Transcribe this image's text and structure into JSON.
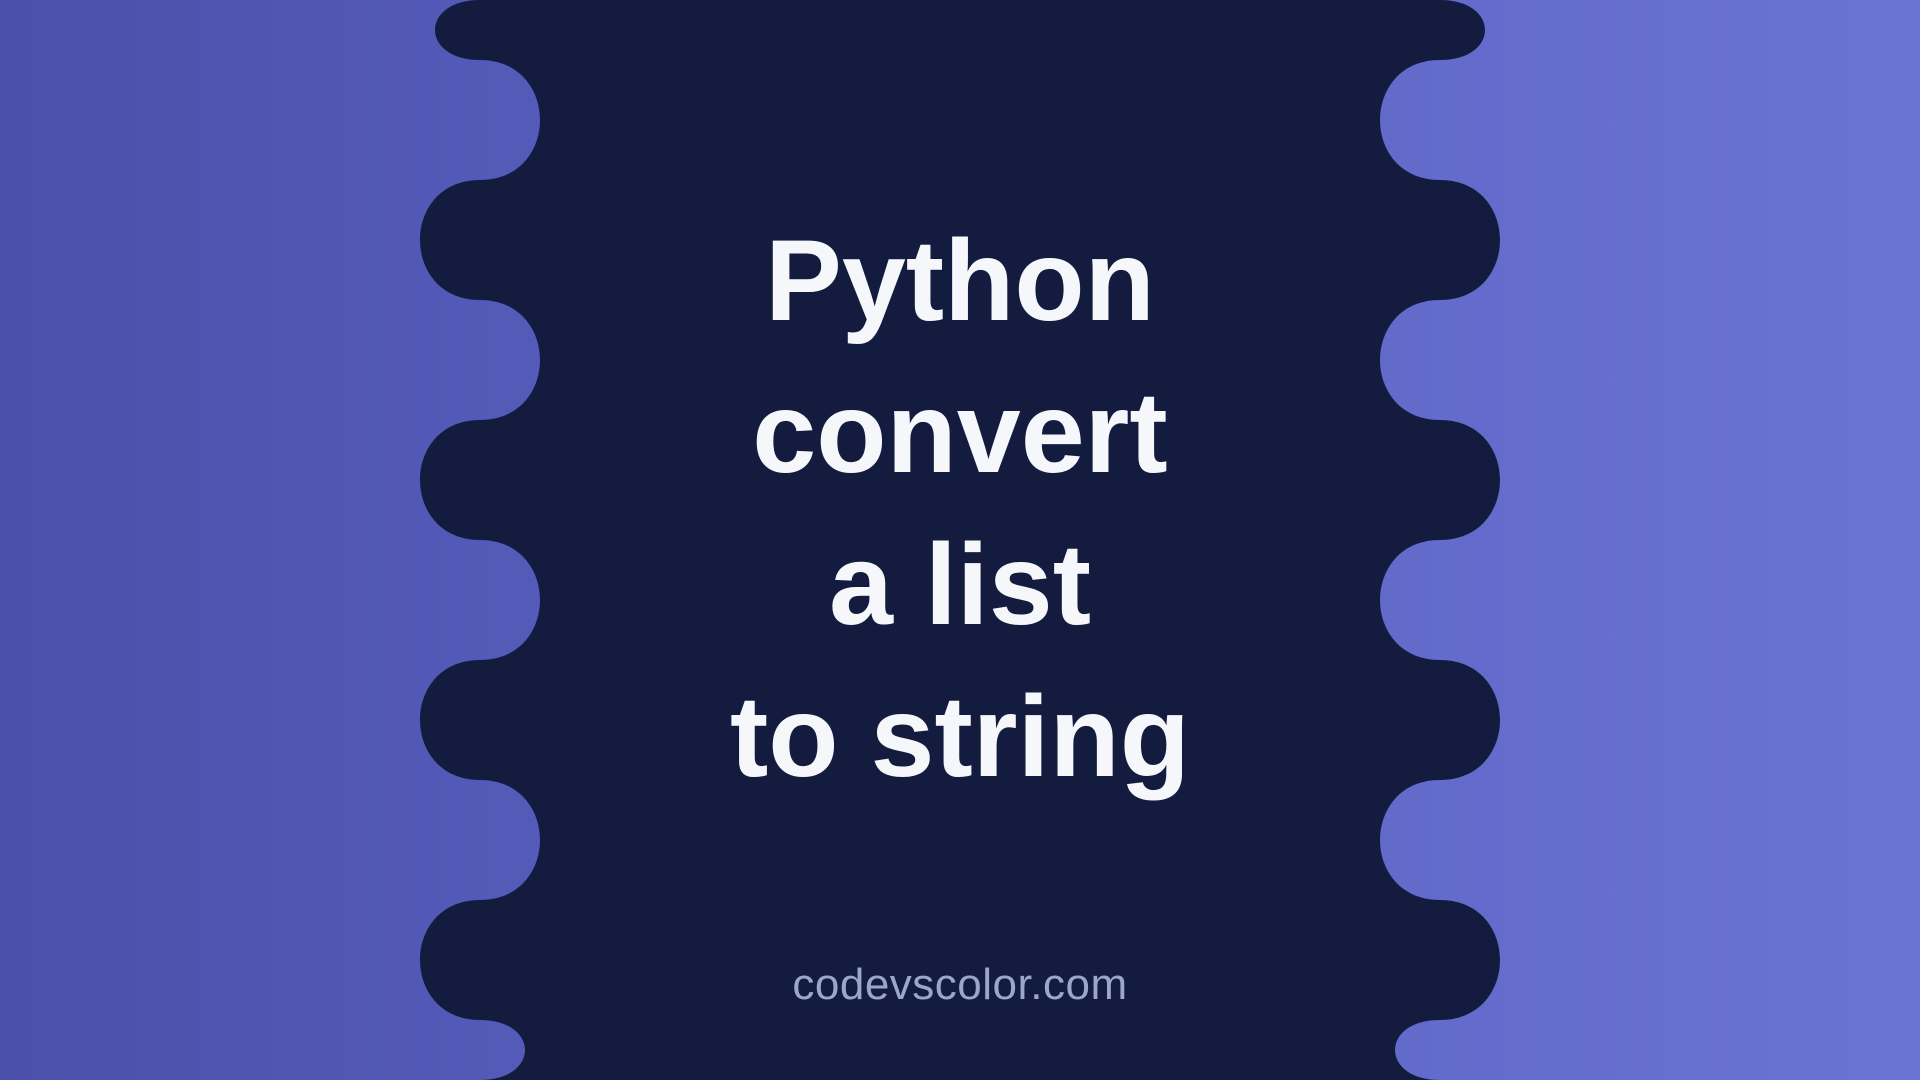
{
  "title": {
    "line1": "Python",
    "line2": "convert",
    "line3": "a list",
    "line4": "to string"
  },
  "brand": "codevscolor.com",
  "colors": {
    "blob": "#131c3f",
    "text": "#f5f7fb",
    "brand": "#9aa7c8"
  }
}
